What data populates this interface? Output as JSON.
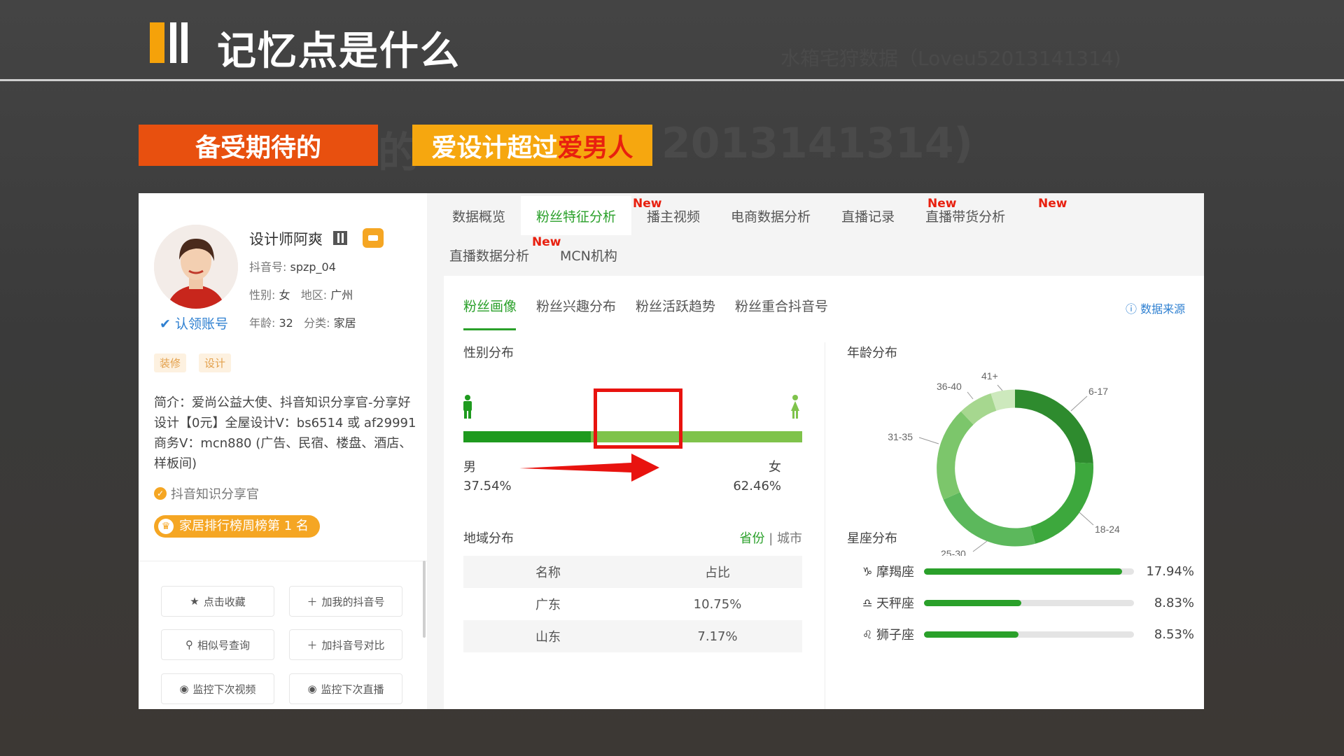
{
  "slide": {
    "title": "记忆点是什么",
    "watermark": "水箱宅狩数据（Loveu52013141314)",
    "watermark_left": "的",
    "watermark_right": "2013141314)",
    "banner_left": "备受期待的",
    "banner_right_part1": "爱设计超过",
    "banner_right_part2": "爱男人"
  },
  "profile": {
    "name": "设计师阿爽",
    "douyin_id_label": "抖音号:",
    "douyin_id": "spzp_04",
    "gender_label": "性别:",
    "gender": "女",
    "region_label": "地区:",
    "region": "广州",
    "age_label": "年龄:",
    "age": "32",
    "category_label": "分类:",
    "category": "家居",
    "claim_label": "认领账号",
    "tags": [
      "装修",
      "设计"
    ],
    "intro": "简介：爱尚公益大使、抖音知识分享官-分享好设计【0元】全屋设计V：bs6514 或 af29991 商务V：mcn880 (广告、民宿、楼盘、酒店、样板间)",
    "badge": "抖音知识分享官",
    "rank": "家居排行榜周榜第 1 名",
    "actions": [
      "点击收藏",
      "加我的抖音号",
      "相似号查询",
      "加抖音号对比",
      "监控下次视频",
      "监控下次直播"
    ]
  },
  "tabs": [
    "数据概览",
    "粉丝特征分析",
    "播主视频",
    "电商数据分析",
    "直播记录",
    "直播带货分析",
    "直播数据分析",
    "MCN机构"
  ],
  "new_label": "New",
  "subtabs": [
    "粉丝画像",
    "粉丝兴趣分布",
    "粉丝活跃趋势",
    "粉丝重合抖音号"
  ],
  "data_source": "数据来源",
  "gender_section": {
    "title": "性别分布",
    "male_label": "男",
    "male_pct": "37.54%",
    "male_value": 37.54,
    "female_label": "女",
    "female_pct": "62.46%",
    "female_value": 62.46
  },
  "age_section": {
    "title": "年龄分布",
    "labels": [
      "6-17",
      "18-24",
      "25-30",
      "31-35",
      "36-40",
      "41+"
    ]
  },
  "region_section": {
    "title": "地域分布",
    "toggle_province": "省份",
    "toggle_sep": "|",
    "toggle_city": "城市",
    "headers": [
      "名称",
      "占比"
    ],
    "rows": [
      {
        "name": "广东",
        "pct": "10.75%"
      },
      {
        "name": "山东",
        "pct": "7.17%"
      }
    ]
  },
  "zodiac_section": {
    "title": "星座分布",
    "rows": [
      {
        "name": "摩羯座",
        "pct": "17.94%",
        "value": 17.94,
        "icon": "capricorn-icon"
      },
      {
        "name": "天秤座",
        "pct": "8.83%",
        "value": 8.83,
        "icon": "libra-icon"
      },
      {
        "name": "狮子座",
        "pct": "8.53%",
        "value": 8.53,
        "icon": "leo-icon"
      }
    ]
  },
  "colors": {
    "accent_green": "#2aa02a",
    "dark_green": "#1e9a1e",
    "banner_orange": "#e8500f",
    "banner_yellow": "#f6a70f",
    "highlight_red": "#e8130f"
  }
}
